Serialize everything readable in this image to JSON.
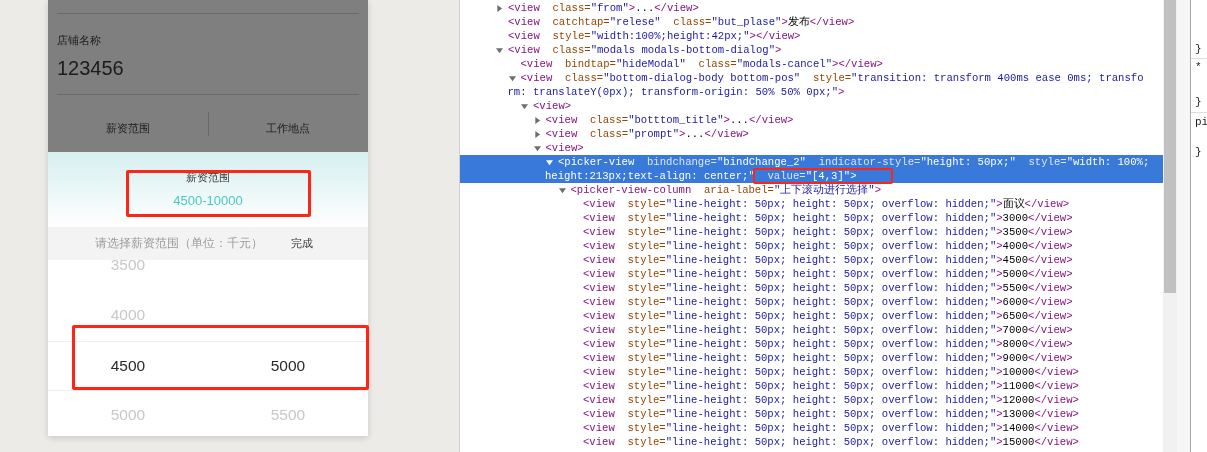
{
  "form": {
    "fields": [
      {
        "label": "店铺名称",
        "value": "123456"
      }
    ],
    "columns": [
      {
        "label": "薪资范围"
      },
      {
        "label": "工作地点"
      }
    ]
  },
  "dialog": {
    "title": "薪资范围",
    "value": "4500-10000",
    "hint": "请选择薪资范围（单位：千元）",
    "done": "完成",
    "picker": {
      "rows": [
        {
          "selected": false,
          "cells": [
            "3500"
          ]
        },
        {
          "selected": false,
          "cells": [
            "4000"
          ]
        },
        {
          "selected": true,
          "cells": [
            "4500",
            "5000"
          ]
        },
        {
          "selected": false,
          "cells": [
            "5000",
            "5500"
          ]
        }
      ]
    }
  },
  "elements": [
    {
      "expanded": false,
      "selected": false,
      "lines": [
        [
          {
            "kind": "tag",
            "text": "<view"
          },
          {
            "kind": "attr",
            "text": "  class="
          },
          {
            "kind": "value",
            "text": "\"from\""
          },
          {
            "kind": "tag",
            "text": ">"
          },
          {
            "kind": "text",
            "text": "..."
          },
          {
            "kind": "tag",
            "text": "</view>"
          }
        ]
      ]
    },
    {
      "selected": false,
      "lines": [
        [
          {
            "kind": "tag",
            "text": "<view"
          },
          {
            "kind": "attr",
            "text": "  catchtap="
          },
          {
            "kind": "value",
            "text": "\"relese\""
          },
          {
            "kind": "attr",
            "text": "  class="
          },
          {
            "kind": "value",
            "text": "\"but_plase\""
          },
          {
            "kind": "tag",
            "text": ">"
          },
          {
            "kind": "text",
            "text": "发布"
          },
          {
            "kind": "tag",
            "text": "</view>"
          }
        ]
      ]
    },
    {
      "selected": false,
      "lines": [
        [
          {
            "kind": "tag",
            "text": "<view"
          },
          {
            "kind": "attr",
            "text": "  style="
          },
          {
            "kind": "value",
            "text": "\"width:100%;height:42px;\""
          },
          {
            "kind": "tag",
            "text": "></view>"
          }
        ]
      ]
    },
    {
      "expanded": true,
      "selected": false,
      "lines": [
        [
          {
            "kind": "tag",
            "text": "<view"
          },
          {
            "kind": "attr",
            "text": "  class="
          },
          {
            "kind": "value",
            "text": "\"modals modals-bottom-dialog\""
          },
          {
            "kind": "tag",
            "text": ">"
          }
        ]
      ],
      "children": [
        {
          "selected": false,
          "lines": [
            [
              {
                "kind": "tag",
                "text": "<view"
              },
              {
                "kind": "attr",
                "text": "  bindtap="
              },
              {
                "kind": "value",
                "text": "\"hideModal\""
              },
              {
                "kind": "attr",
                "text": "  class="
              },
              {
                "kind": "value",
                "text": "\"modals-cancel\""
              },
              {
                "kind": "tag",
                "text": "></view>"
              }
            ]
          ]
        },
        {
          "expanded": true,
          "selected": false,
          "lines": [
            [
              {
                "kind": "tag",
                "text": "<view"
              },
              {
                "kind": "attr",
                "text": "  class="
              },
              {
                "kind": "value",
                "text": "\"bottom-dialog-body bottom-pos\""
              },
              {
                "kind": "attr",
                "text": "  style="
              },
              {
                "kind": "value",
                "text": "\"transition: transform 400ms ease 0ms; transfo"
              }
            ],
            [
              {
                "kind": "value",
                "text": "rm: translateY(0px); transform-origin: 50% 50% 0px;\""
              },
              {
                "kind": "tag",
                "text": ">"
              }
            ]
          ],
          "children": [
            {
              "expanded": true,
              "selected": false,
              "lines": [
                [
                  {
                    "kind": "tag",
                    "text": "<view>"
                  }
                ]
              ],
              "children": [
                {
                  "expanded": false,
                  "selected": false,
                  "lines": [
                    [
                      {
                        "kind": "tag",
                        "text": "<view"
                      },
                      {
                        "kind": "attr",
                        "text": "  class="
                      },
                      {
                        "kind": "value",
                        "text": "\"botttom_title\""
                      },
                      {
                        "kind": "tag",
                        "text": ">"
                      },
                      {
                        "kind": "text",
                        "text": "..."
                      },
                      {
                        "kind": "tag",
                        "text": "</view>"
                      }
                    ]
                  ]
                },
                {
                  "expanded": false,
                  "selected": false,
                  "lines": [
                    [
                      {
                        "kind": "tag",
                        "text": "<view"
                      },
                      {
                        "kind": "attr",
                        "text": "  class="
                      },
                      {
                        "kind": "value",
                        "text": "\"prompt\""
                      },
                      {
                        "kind": "tag",
                        "text": ">"
                      },
                      {
                        "kind": "text",
                        "text": "..."
                      },
                      {
                        "kind": "tag",
                        "text": "</view>"
                      }
                    ]
                  ]
                },
                {
                  "expanded": true,
                  "selected": false,
                  "lines": [
                    [
                      {
                        "kind": "tag",
                        "text": "<view>"
                      }
                    ]
                  ],
                  "children": [
                    {
                      "expanded": true,
                      "selected": true,
                      "lines": [
                        [
                          {
                            "kind": "tag",
                            "text": "<picker-view"
                          },
                          {
                            "kind": "attr",
                            "text": "  bindchange="
                          },
                          {
                            "kind": "value",
                            "text": "\"bindChange_2\""
                          },
                          {
                            "kind": "attr",
                            "text": "  indicator-style="
                          },
                          {
                            "kind": "value",
                            "text": "\"height: 50px;\""
                          },
                          {
                            "kind": "attr",
                            "text": "  style="
                          },
                          {
                            "kind": "value",
                            "text": "\"width: 100%;"
                          }
                        ],
                        [
                          {
                            "kind": "value",
                            "text": "height:213px;text-align: center;\""
                          },
                          {
                            "kind": "attr",
                            "text": "  value="
                          },
                          {
                            "kind": "value",
                            "text": "\"[4,3]\""
                          },
                          {
                            "kind": "tag",
                            "text": ">"
                          }
                        ]
                      ],
                      "children": [
                        {
                          "expanded": true,
                          "selected": false,
                          "lines": [
                            [
                              {
                                "kind": "tag",
                                "text": "<picker-view-column"
                              },
                              {
                                "kind": "attr",
                                "text": "  aria-label="
                              },
                              {
                                "kind": "value",
                                "text": "\"上下滚动进行选择\""
                              },
                              {
                                "kind": "tag",
                                "text": ">"
                              }
                            ]
                          ],
                          "children": [
                            {
                              "selected": false,
                              "lines": [
                                [
                                  {
                                    "kind": "tag",
                                    "text": "<view"
                                  },
                                  {
                                    "kind": "attr",
                                    "text": "  style="
                                  },
                                  {
                                    "kind": "value",
                                    "text": "\"line-height: 50px; height: 50px; overflow: hidden;\""
                                  },
                                  {
                                    "kind": "tag",
                                    "text": ">"
                                  },
                                  {
                                    "kind": "text",
                                    "text": "面议"
                                  },
                                  {
                                    "kind": "tag",
                                    "text": "</view>"
                                  }
                                ]
                              ]
                            },
                            {
                              "selected": false,
                              "lines": [
                                [
                                  {
                                    "kind": "tag",
                                    "text": "<view"
                                  },
                                  {
                                    "kind": "attr",
                                    "text": "  style="
                                  },
                                  {
                                    "kind": "value",
                                    "text": "\"line-height: 50px; height: 50px; overflow: hidden;\""
                                  },
                                  {
                                    "kind": "tag",
                                    "text": ">"
                                  },
                                  {
                                    "kind": "text",
                                    "text": "3000"
                                  },
                                  {
                                    "kind": "tag",
                                    "text": "</view>"
                                  }
                                ]
                              ]
                            },
                            {
                              "selected": false,
                              "lines": [
                                [
                                  {
                                    "kind": "tag",
                                    "text": "<view"
                                  },
                                  {
                                    "kind": "attr",
                                    "text": "  style="
                                  },
                                  {
                                    "kind": "value",
                                    "text": "\"line-height: 50px; height: 50px; overflow: hidden;\""
                                  },
                                  {
                                    "kind": "tag",
                                    "text": ">"
                                  },
                                  {
                                    "kind": "text",
                                    "text": "3500"
                                  },
                                  {
                                    "kind": "tag",
                                    "text": "</view>"
                                  }
                                ]
                              ]
                            },
                            {
                              "selected": false,
                              "lines": [
                                [
                                  {
                                    "kind": "tag",
                                    "text": "<view"
                                  },
                                  {
                                    "kind": "attr",
                                    "text": "  style="
                                  },
                                  {
                                    "kind": "value",
                                    "text": "\"line-height: 50px; height: 50px; overflow: hidden;\""
                                  },
                                  {
                                    "kind": "tag",
                                    "text": ">"
                                  },
                                  {
                                    "kind": "text",
                                    "text": "4000"
                                  },
                                  {
                                    "kind": "tag",
                                    "text": "</view>"
                                  }
                                ]
                              ]
                            },
                            {
                              "selected": false,
                              "lines": [
                                [
                                  {
                                    "kind": "tag",
                                    "text": "<view"
                                  },
                                  {
                                    "kind": "attr",
                                    "text": "  style="
                                  },
                                  {
                                    "kind": "value",
                                    "text": "\"line-height: 50px; height: 50px; overflow: hidden;\""
                                  },
                                  {
                                    "kind": "tag",
                                    "text": ">"
                                  },
                                  {
                                    "kind": "text",
                                    "text": "4500"
                                  },
                                  {
                                    "kind": "tag",
                                    "text": "</view>"
                                  }
                                ]
                              ]
                            },
                            {
                              "selected": false,
                              "lines": [
                                [
                                  {
                                    "kind": "tag",
                                    "text": "<view"
                                  },
                                  {
                                    "kind": "attr",
                                    "text": "  style="
                                  },
                                  {
                                    "kind": "value",
                                    "text": "\"line-height: 50px; height: 50px; overflow: hidden;\""
                                  },
                                  {
                                    "kind": "tag",
                                    "text": ">"
                                  },
                                  {
                                    "kind": "text",
                                    "text": "5000"
                                  },
                                  {
                                    "kind": "tag",
                                    "text": "</view>"
                                  }
                                ]
                              ]
                            },
                            {
                              "selected": false,
                              "lines": [
                                [
                                  {
                                    "kind": "tag",
                                    "text": "<view"
                                  },
                                  {
                                    "kind": "attr",
                                    "text": "  style="
                                  },
                                  {
                                    "kind": "value",
                                    "text": "\"line-height: 50px; height: 50px; overflow: hidden;\""
                                  },
                                  {
                                    "kind": "tag",
                                    "text": ">"
                                  },
                                  {
                                    "kind": "text",
                                    "text": "5500"
                                  },
                                  {
                                    "kind": "tag",
                                    "text": "</view>"
                                  }
                                ]
                              ]
                            },
                            {
                              "selected": false,
                              "lines": [
                                [
                                  {
                                    "kind": "tag",
                                    "text": "<view"
                                  },
                                  {
                                    "kind": "attr",
                                    "text": "  style="
                                  },
                                  {
                                    "kind": "value",
                                    "text": "\"line-height: 50px; height: 50px; overflow: hidden;\""
                                  },
                                  {
                                    "kind": "tag",
                                    "text": ">"
                                  },
                                  {
                                    "kind": "text",
                                    "text": "6000"
                                  },
                                  {
                                    "kind": "tag",
                                    "text": "</view>"
                                  }
                                ]
                              ]
                            },
                            {
                              "selected": false,
                              "lines": [
                                [
                                  {
                                    "kind": "tag",
                                    "text": "<view"
                                  },
                                  {
                                    "kind": "attr",
                                    "text": "  style="
                                  },
                                  {
                                    "kind": "value",
                                    "text": "\"line-height: 50px; height: 50px; overflow: hidden;\""
                                  },
                                  {
                                    "kind": "tag",
                                    "text": ">"
                                  },
                                  {
                                    "kind": "text",
                                    "text": "6500"
                                  },
                                  {
                                    "kind": "tag",
                                    "text": "</view>"
                                  }
                                ]
                              ]
                            },
                            {
                              "selected": false,
                              "lines": [
                                [
                                  {
                                    "kind": "tag",
                                    "text": "<view"
                                  },
                                  {
                                    "kind": "attr",
                                    "text": "  style="
                                  },
                                  {
                                    "kind": "value",
                                    "text": "\"line-height: 50px; height: 50px; overflow: hidden;\""
                                  },
                                  {
                                    "kind": "tag",
                                    "text": ">"
                                  },
                                  {
                                    "kind": "text",
                                    "text": "7000"
                                  },
                                  {
                                    "kind": "tag",
                                    "text": "</view>"
                                  }
                                ]
                              ]
                            },
                            {
                              "selected": false,
                              "lines": [
                                [
                                  {
                                    "kind": "tag",
                                    "text": "<view"
                                  },
                                  {
                                    "kind": "attr",
                                    "text": "  style="
                                  },
                                  {
                                    "kind": "value",
                                    "text": "\"line-height: 50px; height: 50px; overflow: hidden;\""
                                  },
                                  {
                                    "kind": "tag",
                                    "text": ">"
                                  },
                                  {
                                    "kind": "text",
                                    "text": "8000"
                                  },
                                  {
                                    "kind": "tag",
                                    "text": "</view>"
                                  }
                                ]
                              ]
                            },
                            {
                              "selected": false,
                              "lines": [
                                [
                                  {
                                    "kind": "tag",
                                    "text": "<view"
                                  },
                                  {
                                    "kind": "attr",
                                    "text": "  style="
                                  },
                                  {
                                    "kind": "value",
                                    "text": "\"line-height: 50px; height: 50px; overflow: hidden;\""
                                  },
                                  {
                                    "kind": "tag",
                                    "text": ">"
                                  },
                                  {
                                    "kind": "text",
                                    "text": "9000"
                                  },
                                  {
                                    "kind": "tag",
                                    "text": "</view>"
                                  }
                                ]
                              ]
                            },
                            {
                              "selected": false,
                              "lines": [
                                [
                                  {
                                    "kind": "tag",
                                    "text": "<view"
                                  },
                                  {
                                    "kind": "attr",
                                    "text": "  style="
                                  },
                                  {
                                    "kind": "value",
                                    "text": "\"line-height: 50px; height: 50px; overflow: hidden;\""
                                  },
                                  {
                                    "kind": "tag",
                                    "text": ">"
                                  },
                                  {
                                    "kind": "text",
                                    "text": "10000"
                                  },
                                  {
                                    "kind": "tag",
                                    "text": "</view>"
                                  }
                                ]
                              ]
                            },
                            {
                              "selected": false,
                              "lines": [
                                [
                                  {
                                    "kind": "tag",
                                    "text": "<view"
                                  },
                                  {
                                    "kind": "attr",
                                    "text": "  style="
                                  },
                                  {
                                    "kind": "value",
                                    "text": "\"line-height: 50px; height: 50px; overflow: hidden;\""
                                  },
                                  {
                                    "kind": "tag",
                                    "text": ">"
                                  },
                                  {
                                    "kind": "text",
                                    "text": "11000"
                                  },
                                  {
                                    "kind": "tag",
                                    "text": "</view>"
                                  }
                                ]
                              ]
                            },
                            {
                              "selected": false,
                              "lines": [
                                [
                                  {
                                    "kind": "tag",
                                    "text": "<view"
                                  },
                                  {
                                    "kind": "attr",
                                    "text": "  style="
                                  },
                                  {
                                    "kind": "value",
                                    "text": "\"line-height: 50px; height: 50px; overflow: hidden;\""
                                  },
                                  {
                                    "kind": "tag",
                                    "text": ">"
                                  },
                                  {
                                    "kind": "text",
                                    "text": "12000"
                                  },
                                  {
                                    "kind": "tag",
                                    "text": "</view>"
                                  }
                                ]
                              ]
                            },
                            {
                              "selected": false,
                              "lines": [
                                [
                                  {
                                    "kind": "tag",
                                    "text": "<view"
                                  },
                                  {
                                    "kind": "attr",
                                    "text": "  style="
                                  },
                                  {
                                    "kind": "value",
                                    "text": "\"line-height: 50px; height: 50px; overflow: hidden;\""
                                  },
                                  {
                                    "kind": "tag",
                                    "text": ">"
                                  },
                                  {
                                    "kind": "text",
                                    "text": "13000"
                                  },
                                  {
                                    "kind": "tag",
                                    "text": "</view>"
                                  }
                                ]
                              ]
                            },
                            {
                              "selected": false,
                              "lines": [
                                [
                                  {
                                    "kind": "tag",
                                    "text": "<view"
                                  },
                                  {
                                    "kind": "attr",
                                    "text": "  style="
                                  },
                                  {
                                    "kind": "value",
                                    "text": "\"line-height: 50px; height: 50px; overflow: hidden;\""
                                  },
                                  {
                                    "kind": "tag",
                                    "text": ">"
                                  },
                                  {
                                    "kind": "text",
                                    "text": "14000"
                                  },
                                  {
                                    "kind": "tag",
                                    "text": "</view>"
                                  }
                                ]
                              ]
                            },
                            {
                              "selected": false,
                              "lines": [
                                [
                                  {
                                    "kind": "tag",
                                    "text": "<view"
                                  },
                                  {
                                    "kind": "attr",
                                    "text": "  style="
                                  },
                                  {
                                    "kind": "value",
                                    "text": "\"line-height: 50px; height: 50px; overflow: hidden;\""
                                  },
                                  {
                                    "kind": "tag",
                                    "text": ">"
                                  },
                                  {
                                    "kind": "text",
                                    "text": "15000"
                                  },
                                  {
                                    "kind": "tag",
                                    "text": "</view>"
                                  }
                                ]
                              ]
                            }
                          ]
                        }
                      ]
                    }
                  ]
                }
              ]
            }
          ]
        }
      ]
    }
  ],
  "styles_pane": {
    "blocks": [
      [
        "}"
      ],
      [
        "*",
        "}"
      ],
      [
        "pi",
        "}"
      ]
    ]
  }
}
